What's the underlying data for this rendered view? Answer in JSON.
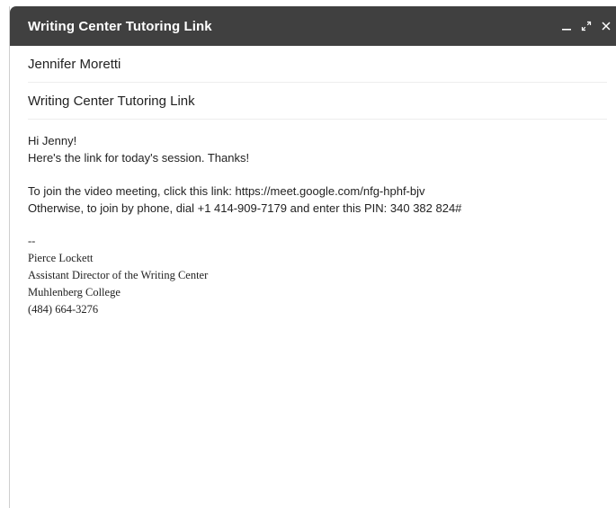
{
  "window": {
    "title": "Writing Center Tutoring Link",
    "controls": {
      "minimize_icon": "minimize-icon",
      "expand_icon": "expand-icon",
      "close_icon": "close-icon"
    }
  },
  "compose": {
    "to": "Jennifer Moretti",
    "subject": "Writing Center Tutoring Link",
    "body": {
      "greeting": "Hi Jenny!",
      "line1": "Here's the link for today's session. Thanks!",
      "video_line": "To join the video meeting, click this link: https://meet.google.com/nfg-hphf-bjv",
      "phone_line": "Otherwise, to join by phone, dial +1 414-909-7179 and enter this PIN: 340 382 824#"
    },
    "signature": {
      "separator": "--",
      "name": "Pierce Lockett",
      "title": "Assistant Director of the Writing Center",
      "org": "Muhlenberg College",
      "phone": "(484) 664-3276"
    }
  },
  "colors": {
    "titlebar_bg": "#404040",
    "title_text": "#ffffff",
    "body_text": "#222222",
    "divider": "#ededed"
  }
}
